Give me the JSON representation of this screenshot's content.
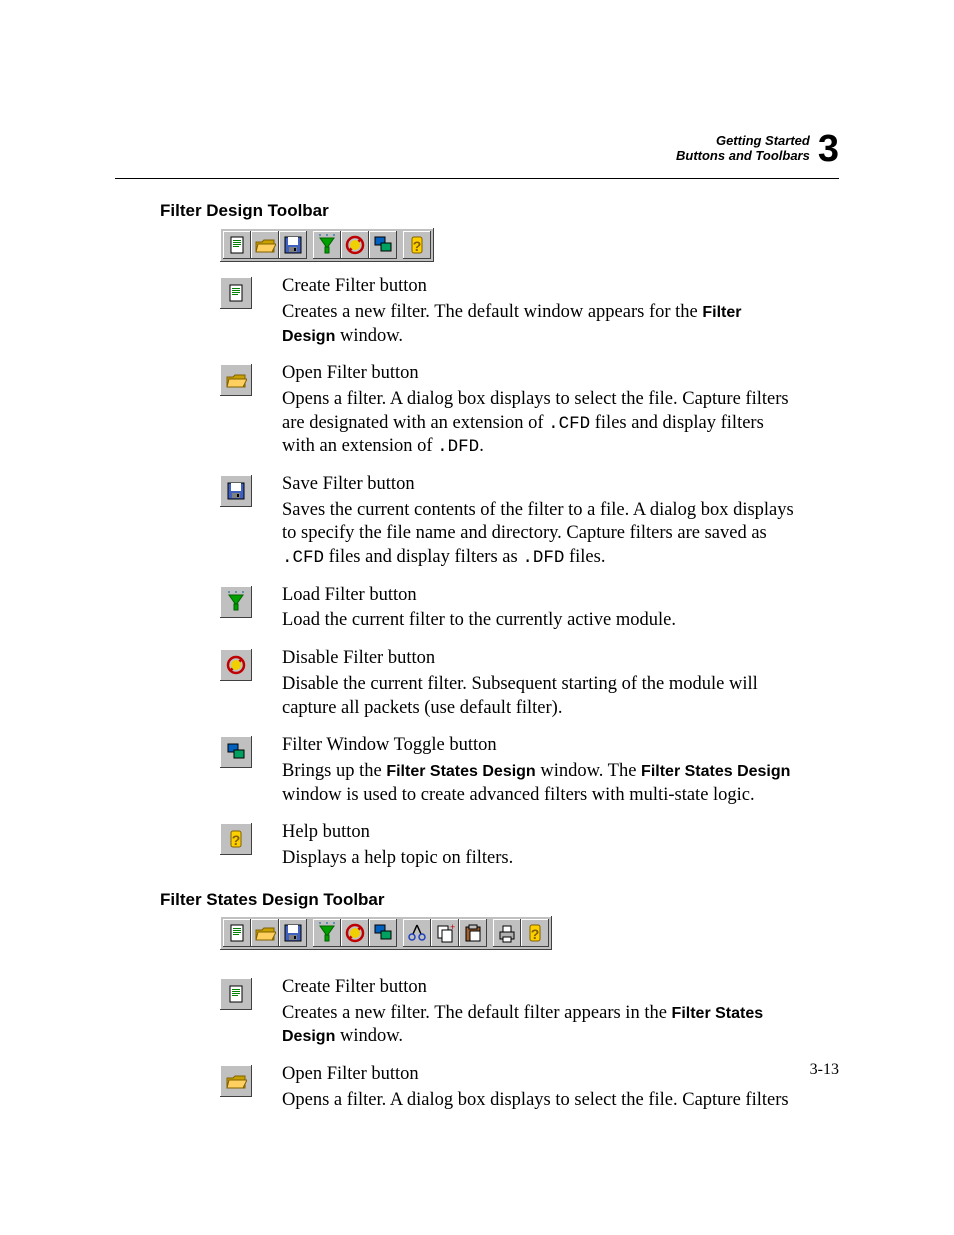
{
  "header": {
    "line1": "Getting Started",
    "line2": "Buttons and Toolbars",
    "chapter": "3"
  },
  "pageno": "3-13",
  "section1_title": "Filter Design Toolbar",
  "section2_title": "Filter States Design Toolbar",
  "s1": {
    "create": {
      "title": "Create Filter button",
      "text_a": "Creates a new filter. The default window appears for the ",
      "bold_a": "Filter Design",
      "text_b": " window."
    },
    "open": {
      "title": "Open Filter button",
      "text_a": "Opens a filter. A dialog box displays to select the file. Capture filters are designated with an extension of ",
      "code_a": ".CFD",
      "text_b": " files and display filters with an extension of ",
      "code_b": ".DFD",
      "text_c": "."
    },
    "save": {
      "title": "Save Filter button",
      "text_a": "Saves the current contents of the filter to a file. A dialog box displays to specify the file name and directory. Capture filters are saved as ",
      "code_a": ".CFD",
      "text_b": " files and display filters as ",
      "code_b": ".DFD",
      "text_c": " files."
    },
    "load": {
      "title": "Load Filter button",
      "text_a": "Load the current filter to the currently active module."
    },
    "disable": {
      "title": "Disable Filter button",
      "text_a": "Disable the current filter. Subsequent starting of the module will capture all packets (use default filter)."
    },
    "toggle": {
      "title": "Filter Window Toggle button",
      "text_a": "Brings up the ",
      "bold_a": "Filter States Design",
      "text_b": " window. The ",
      "bold_b": "Filter States Design",
      "text_c": " window is used to create advanced filters with multi-state logic."
    },
    "help": {
      "title": "Help button",
      "text_a": "Displays a help topic on filters."
    }
  },
  "s2": {
    "create": {
      "title": "Create Filter button",
      "text_a": "Creates a new filter. The default filter appears in the ",
      "bold_a": "Filter States Design",
      "text_b": " window."
    },
    "open": {
      "title": "Open Filter button",
      "text_a": "Opens a filter. A dialog box displays to select the file. Capture filters"
    }
  }
}
